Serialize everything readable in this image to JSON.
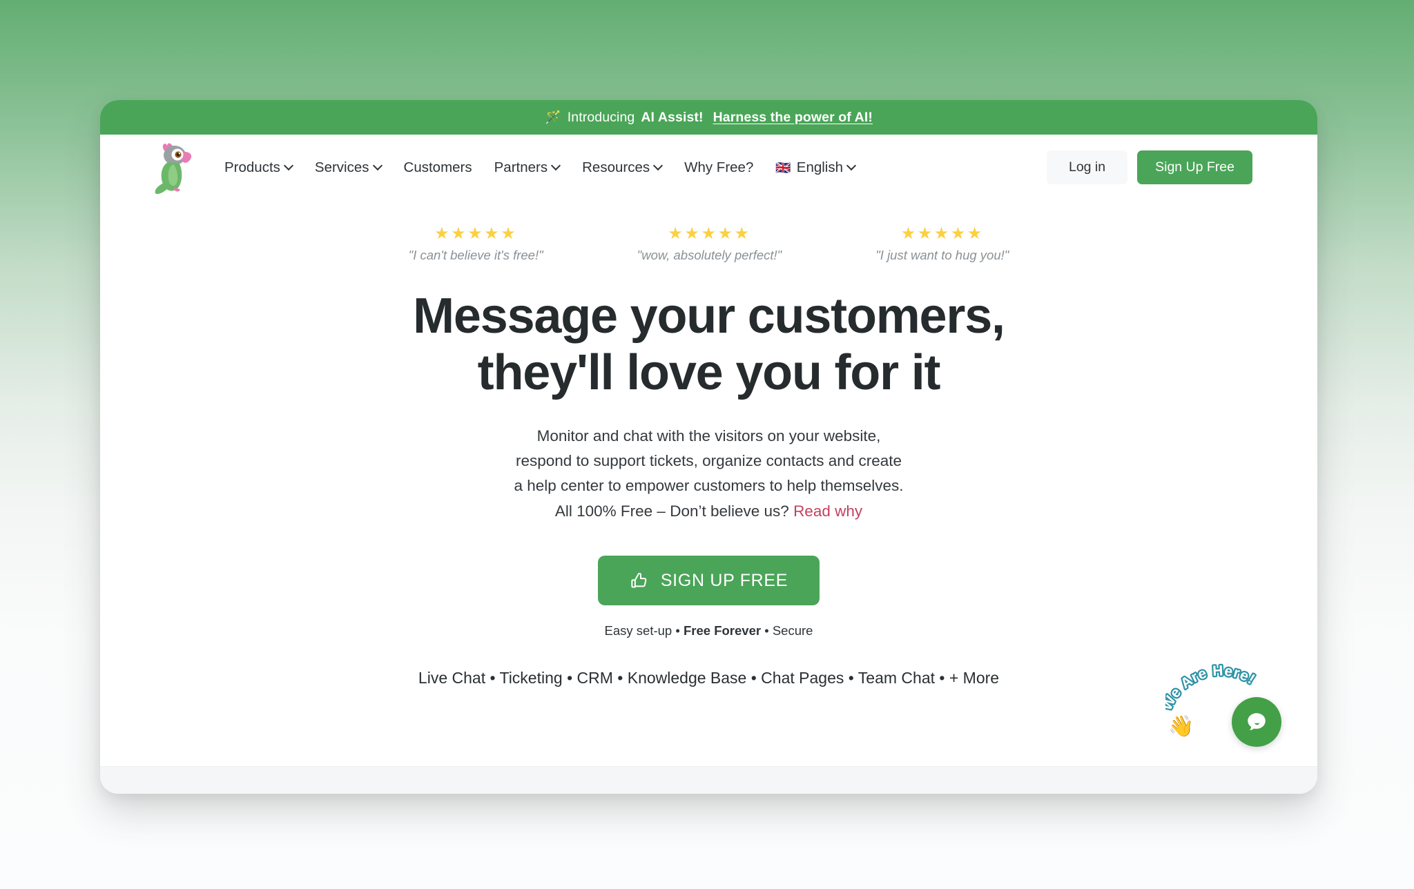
{
  "announcement": {
    "icon": "magic-wand-icon",
    "icon_glyph": "🪄",
    "text_plain": "Introducing ",
    "text_strong": "AI Assist!",
    "link_label": "Harness the power of AI!"
  },
  "nav": {
    "logo_name": "parrot-logo",
    "items": [
      {
        "label": "Products",
        "has_dropdown": true
      },
      {
        "label": "Services",
        "has_dropdown": true
      },
      {
        "label": "Customers",
        "has_dropdown": false
      },
      {
        "label": "Partners",
        "has_dropdown": true
      },
      {
        "label": "Resources",
        "has_dropdown": true
      },
      {
        "label": "Why Free?",
        "has_dropdown": false
      }
    ],
    "language": {
      "flag_glyph": "🇬🇧",
      "label": "English"
    },
    "login_label": "Log in",
    "signup_label": "Sign Up Free"
  },
  "hero": {
    "testimonials": [
      {
        "stars": "★★★★★",
        "rating": 5,
        "quote": "\"I can't believe it's free!\""
      },
      {
        "stars": "★★★★★",
        "rating": 5,
        "quote": "\"wow, absolutely perfect!\""
      },
      {
        "stars": "★★★★★",
        "rating": 5,
        "quote": "\"I just want to hug you!\""
      }
    ],
    "headline_line1": "Message your customers,",
    "headline_line2": "they'll love you for it",
    "subhead_line1": "Monitor and chat with the visitors on your website,",
    "subhead_line2": "respond to support tickets, organize contacts and create",
    "subhead_line3": "a help center to empower customers to help themselves.",
    "subhead_line4_text": "All 100% Free – Don’t believe us? ",
    "subhead_line4_link": "Read why",
    "cta_label": "SIGN UP FREE",
    "cta_icon": "thumbs-up-icon",
    "trust_part1": "Easy set-up • ",
    "trust_part2_bold": "Free Forever",
    "trust_part3": " • Secure",
    "feature_line": "Live Chat • Ticketing • CRM • Knowledge Base • Chat Pages • Team Chat • + More"
  },
  "chat_widget": {
    "label": "We Are Here!",
    "wave_glyph": "👋",
    "launcher_icon": "chat-bubble-icon"
  },
  "colors": {
    "brand_green": "#4aa558",
    "launcher_green": "#43a047",
    "star_yellow": "#fbd042",
    "link_pink": "#c3405e",
    "heading_dark": "#262b2e",
    "muted_gray": "#8a9196",
    "label_teal": "#2f93a8"
  }
}
